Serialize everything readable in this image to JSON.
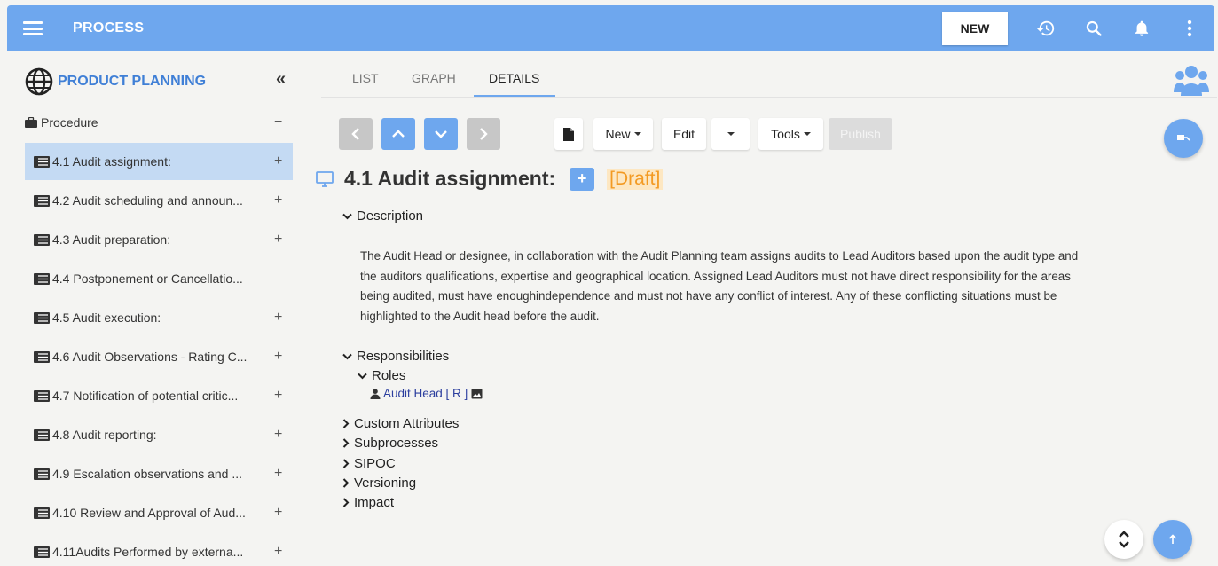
{
  "header": {
    "title": "PROCESS",
    "new_label": "NEW",
    "icons": [
      "menu-icon",
      "history-icon",
      "search-icon",
      "bell-icon",
      "more-vertical-icon"
    ]
  },
  "sidebar": {
    "project_title": "PRODUCT PLANNING",
    "collapse_label": "«",
    "group_label": "Procedure",
    "group_toggle": "−",
    "items": [
      {
        "label": "4.1 Audit assignment:",
        "toggle": "+"
      },
      {
        "label": "4.2 Audit scheduling and announ...",
        "toggle": "+"
      },
      {
        "label": "4.3 Audit preparation:",
        "toggle": "+"
      },
      {
        "label": "4.4 Postponement or Cancellatio...",
        "toggle": ""
      },
      {
        "label": "4.5 Audit execution:",
        "toggle": "+"
      },
      {
        "label": "4.6 Audit Observations - Rating C...",
        "toggle": "+"
      },
      {
        "label": "4.7 Notification of potential critic...",
        "toggle": "+"
      },
      {
        "label": "4.8 Audit reporting:",
        "toggle": "+"
      },
      {
        "label": "4.9 Escalation observations and ...",
        "toggle": "+"
      },
      {
        "label": "4.10 Review and Approval of Aud...",
        "toggle": "+"
      },
      {
        "label": "4.11Audits Performed by externa...",
        "toggle": "+"
      }
    ]
  },
  "tabs": [
    {
      "label": "LIST"
    },
    {
      "label": "GRAPH"
    },
    {
      "label": "DETAILS"
    }
  ],
  "toolbar": {
    "new_label": "New",
    "edit_label": "Edit",
    "tools_label": "Tools",
    "publish_label": "Publish"
  },
  "detail": {
    "title": "4.1 Audit assignment:",
    "add_label": "+",
    "status": "[Draft]",
    "description_label": "Description",
    "description_lines": [
      "The Audit Head or designee, in collaboration with the Audit Planning team assigns audits to Lead Auditors based upon the audit type and",
      "the auditors qualifications, expertise and geographical location. Assigned Lead Auditors must not have direct responsibility for the areas",
      "being audited, must have enoughindependence and must not have any conflict of interest. Any of these conflicting situations must be",
      "highlighted to the Audit head before the audit."
    ],
    "responsibilities_label": "Responsibilities",
    "roles_label": "Roles",
    "role_entry": "Audit Head [ R ]",
    "sections": [
      "Custom Attributes",
      "Subprocesses",
      "SIPOC",
      "Versioning",
      "Impact"
    ]
  },
  "colors": {
    "accent": "#6ea7ee",
    "selected_row": "#c4daf3",
    "draft_text": "#f39a22",
    "draft_bg": "#fde7c2",
    "link": "#2b3e9e"
  }
}
